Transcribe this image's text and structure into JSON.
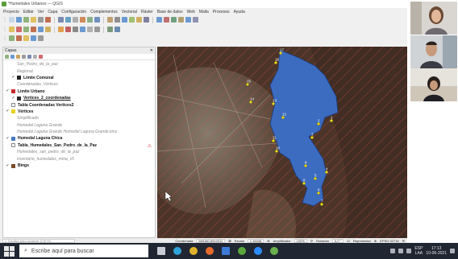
{
  "window": {
    "title": "*Humedales Urbanos — QGIS"
  },
  "menu": [
    "Proyecto",
    "Editar",
    "Ver",
    "Capa",
    "Configuración",
    "Complementos",
    "Vectorial",
    "Ráster",
    "Base de datos",
    "Web",
    "Malla",
    "Procesos",
    "Ayuda"
  ],
  "panel": {
    "title": "Capas",
    "layers": [
      {
        "label": "San_Pedro_de_la_paz",
        "checked": false,
        "symbol": "",
        "indent": 1,
        "style": "off"
      },
      {
        "label": "Regional",
        "checked": false,
        "symbol": "",
        "indent": 1,
        "style": "off"
      },
      {
        "label": "Limite Comunal",
        "checked": true,
        "symbol": "#222222",
        "indent": 1,
        "style": "bold"
      },
      {
        "label": "Coordenadas_Vértices",
        "checked": false,
        "symbol": "",
        "indent": 1,
        "style": "off"
      },
      {
        "label": "Limite Urbano",
        "checked": true,
        "symbol": "#cc2a2a",
        "indent": 0,
        "style": "bold"
      },
      {
        "label": "Vertices_2_coordenadas",
        "checked": true,
        "symbol": "#2a2a2a",
        "indent": 1,
        "style": "bold underline"
      },
      {
        "label": "Tabla Coordenadas Vertices2",
        "checked": null,
        "symbol": "",
        "indent": 0,
        "style": "bold"
      },
      {
        "label": "Vértices",
        "checked": true,
        "symbol": "#e8d21e",
        "indent": 0,
        "style": "bold"
      },
      {
        "label": "Simplificado",
        "checked": false,
        "symbol": "",
        "indent": 1,
        "style": "off"
      },
      {
        "label": "Humedal Laguna Grande",
        "checked": false,
        "symbol": "",
        "indent": 1,
        "style": "off"
      },
      {
        "label": "Humedal Laguna Grande Humedal Laguna Grande.kmz",
        "checked": false,
        "symbol": "",
        "indent": 1,
        "style": "off"
      },
      {
        "label": "Humedal Laguna Chica",
        "checked": true,
        "symbol": "#4a78c4",
        "indent": 0,
        "style": "bold"
      },
      {
        "label": "Tabla_Humedales_San_Pedro_de_la_Paz",
        "checked": null,
        "symbol": "",
        "indent": 0,
        "style": "bold",
        "warning": true
      },
      {
        "label": "Humedales_san_pedro_de_la_paz",
        "checked": false,
        "symbol": "",
        "indent": 1,
        "style": "off"
      },
      {
        "label": "inventario_humedales_mma_v5",
        "checked": false,
        "symbol": "",
        "indent": 1,
        "style": "off"
      },
      {
        "label": "Bings",
        "checked": true,
        "symbol": "#7a4a2a",
        "indent": 0,
        "style": "bold"
      }
    ]
  },
  "map": {
    "lake_color": "#3c6cc0",
    "vertex_color": "#f2e21a",
    "vertex_labels": [
      "17",
      "16",
      "15",
      "14",
      "13",
      "12",
      "11",
      "10",
      "9",
      "8",
      "7",
      "6",
      "5",
      "4",
      "3",
      "2",
      "1"
    ]
  },
  "status": {
    "locator_placeholder": "Escriba para localizar (Ctrl+K)",
    "coord_label": "Coordenada",
    "coord_value": "669180,5919312",
    "scale_label": "Escala",
    "scale_value": "1:16046",
    "magnifier_label": "Amplificador",
    "magnifier_value": "100%",
    "rotation_label": "Rotación",
    "rotation_value": "0,0 °",
    "render_label": "Representar",
    "crs": "EPSG:32718"
  },
  "taskbar": {
    "search_placeholder": "Escribe aquí para buscar",
    "lang_top": "ESP",
    "lang_bottom": "LAA",
    "time": "17:13",
    "date": "10-06-2021"
  }
}
